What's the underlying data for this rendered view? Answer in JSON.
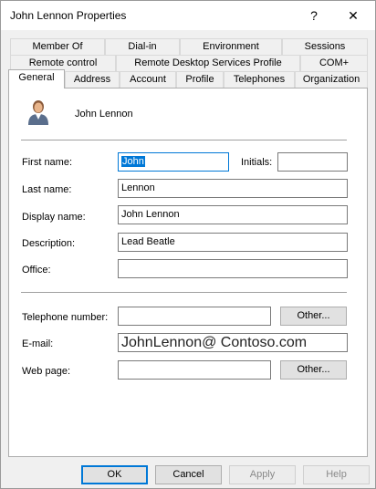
{
  "window": {
    "title": "John Lennon Properties",
    "help_glyph": "?",
    "close_glyph": "✕"
  },
  "tabs": {
    "row1": [
      "Member Of",
      "Dial-in",
      "Environment",
      "Sessions"
    ],
    "row2": [
      "Remote control",
      "Remote Desktop Services Profile",
      "COM+"
    ],
    "row3": [
      "General",
      "Address",
      "Account",
      "Profile",
      "Telephones",
      "Organization"
    ],
    "active": "General"
  },
  "general": {
    "user_name": "John Lennon",
    "avatar_icon": "user-icon",
    "first_name_label": "First name:",
    "first_name": "John",
    "initials_label": "Initials:",
    "initials": "",
    "last_name_label": "Last name:",
    "last_name": "Lennon",
    "display_name_label": "Display name:",
    "display_name": "John Lennon",
    "description_label": "Description:",
    "description": "Lead Beatle",
    "office_label": "Office:",
    "office": "",
    "telephone_label": "Telephone number:",
    "telephone": "",
    "telephone_other": "Other...",
    "email_label": "E-mail:",
    "email": "JohnLennon@ Contoso.com",
    "webpage_label": "Web page:",
    "webpage": "",
    "webpage_other": "Other..."
  },
  "footer": {
    "ok": "OK",
    "cancel": "Cancel",
    "apply": "Apply",
    "help": "Help"
  },
  "colors": {
    "accent": "#0078d7",
    "panel": "#ffffff",
    "dialog": "#f0f0f0"
  }
}
